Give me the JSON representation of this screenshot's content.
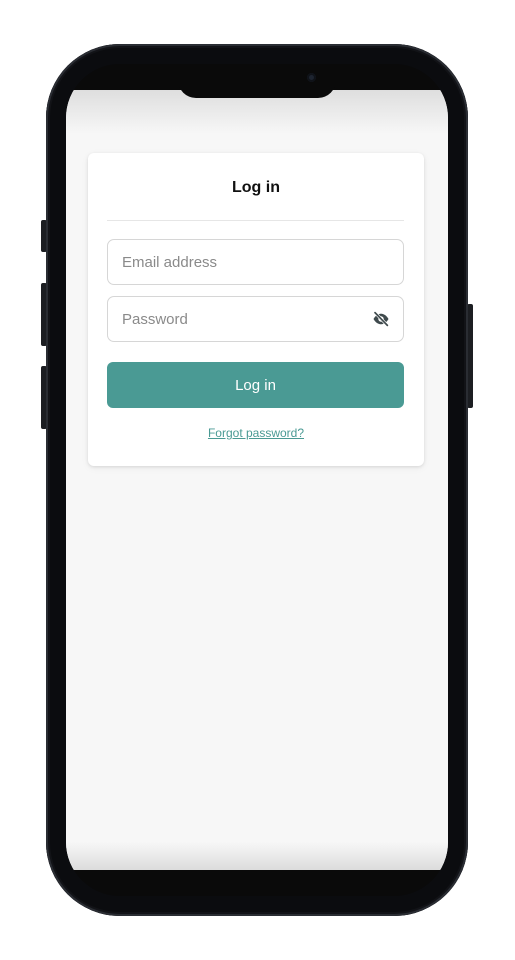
{
  "login": {
    "title": "Log in",
    "email_placeholder": "Email address",
    "password_placeholder": "Password",
    "login_button_label": "Log in",
    "forgot_password_link": "Forgot password?"
  },
  "icons": {
    "password_toggle": "eye-off-icon"
  },
  "colors": {
    "accent": "#4a9a94",
    "background": "#f7f7f7",
    "card": "#ffffff",
    "phone_frame": "#0b0c0f"
  }
}
